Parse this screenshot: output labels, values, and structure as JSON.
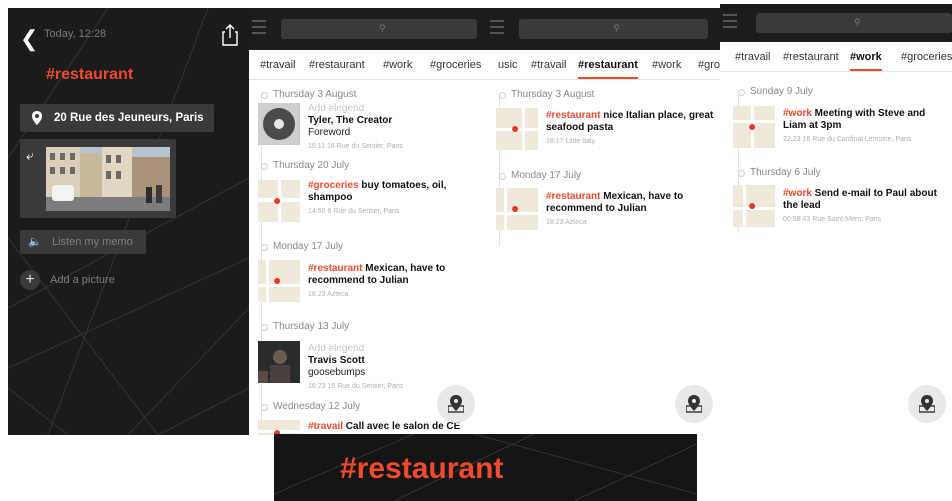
{
  "detail": {
    "time": "Today, 12:28",
    "tag_title": "#restaurant",
    "address": "20 Rue des Jeuneurs, Paris",
    "memo_label": "Listen my memo",
    "add_picture_label": "Add a picture"
  },
  "screens": [
    {
      "tabs": [
        "#travail",
        "#restaurant",
        "#work",
        "#groceries"
      ],
      "active_tab": "",
      "groups": [
        {
          "day": "Thursday 3 August",
          "entries": [
            {
              "thumb": "vinyl",
              "legend": "Add #legend",
              "title": "Tyler, The Creator",
              "sub": "Foreword",
              "meta": "15:11  16 Rue du Sentier, Paris"
            }
          ]
        },
        {
          "day": "Thursday 20 July",
          "entries": [
            {
              "thumb": "map",
              "tag": "#groceries",
              "text": " buy tomatoes, oil, shampoo",
              "meta": "14:50  6 Rue du Sentier, Paris"
            }
          ]
        },
        {
          "day": "Monday 17 July",
          "entries": [
            {
              "thumb": "map",
              "tag": "#restaurant",
              "text": " Mexican, have to recommend to Julian",
              "meta": "18:23  Azteca"
            }
          ]
        },
        {
          "day": "Thursday 13 July",
          "entries": [
            {
              "thumb": "album",
              "legend": "Add #legend",
              "title": "Travis Scott",
              "sub": "goosebumps",
              "meta": "16:23  16 Rue du Sentier, Paris"
            }
          ]
        },
        {
          "day": "Wednesday 12 July",
          "entries": [
            {
              "thumb": "map",
              "tag": "#travail",
              "text": " Call avec le salon de CE",
              "meta": ""
            }
          ]
        }
      ]
    },
    {
      "tabs": [
        "usic",
        "#travail",
        "#restaurant",
        "#work",
        "#gro"
      ],
      "active_tab": "#restaurant",
      "groups": [
        {
          "day": "Thursday 3 August",
          "entries": [
            {
              "thumb": "map",
              "tag": "#restaurant",
              "text": " nice Italian place, great seafood pasta",
              "meta": "18:17  Little Italy"
            }
          ]
        },
        {
          "day": "Monday 17 July",
          "entries": [
            {
              "thumb": "map",
              "tag": "#restaurant",
              "text": " Mexican, have to recommend to Julian",
              "meta": "18:23  Azteca"
            }
          ]
        }
      ]
    },
    {
      "tabs": [
        "#travail",
        "#restaurant",
        "#work",
        "#groceries"
      ],
      "active_tab": "#work",
      "groups": [
        {
          "day": "Sunday 9 July",
          "entries": [
            {
              "thumb": "map",
              "tag": "#work",
              "text": " Meeting with Steve and Liam at 3pm",
              "meta": "22:23  16 Rue du Cardinal Lemoine, Paris"
            }
          ]
        },
        {
          "day": "Thursday 6 July",
          "entries": [
            {
              "thumb": "map",
              "tag": "#work",
              "text": " Send e-mail to Paul about the lead",
              "meta": "00:58  43 Rue Saint-Merri, Paris"
            }
          ]
        }
      ]
    }
  ],
  "banner": {
    "title": "#restaurant"
  },
  "colors": {
    "accent": "#ef4b2c",
    "dark": "#1b1b1b",
    "field": "#3a3a3a"
  },
  "icons": [
    "back-arrow-icon",
    "share-icon",
    "location-pin-icon",
    "undo-icon",
    "speaker-icon",
    "plus-icon",
    "search-icon",
    "menu-icon",
    "map-marker-icon"
  ]
}
